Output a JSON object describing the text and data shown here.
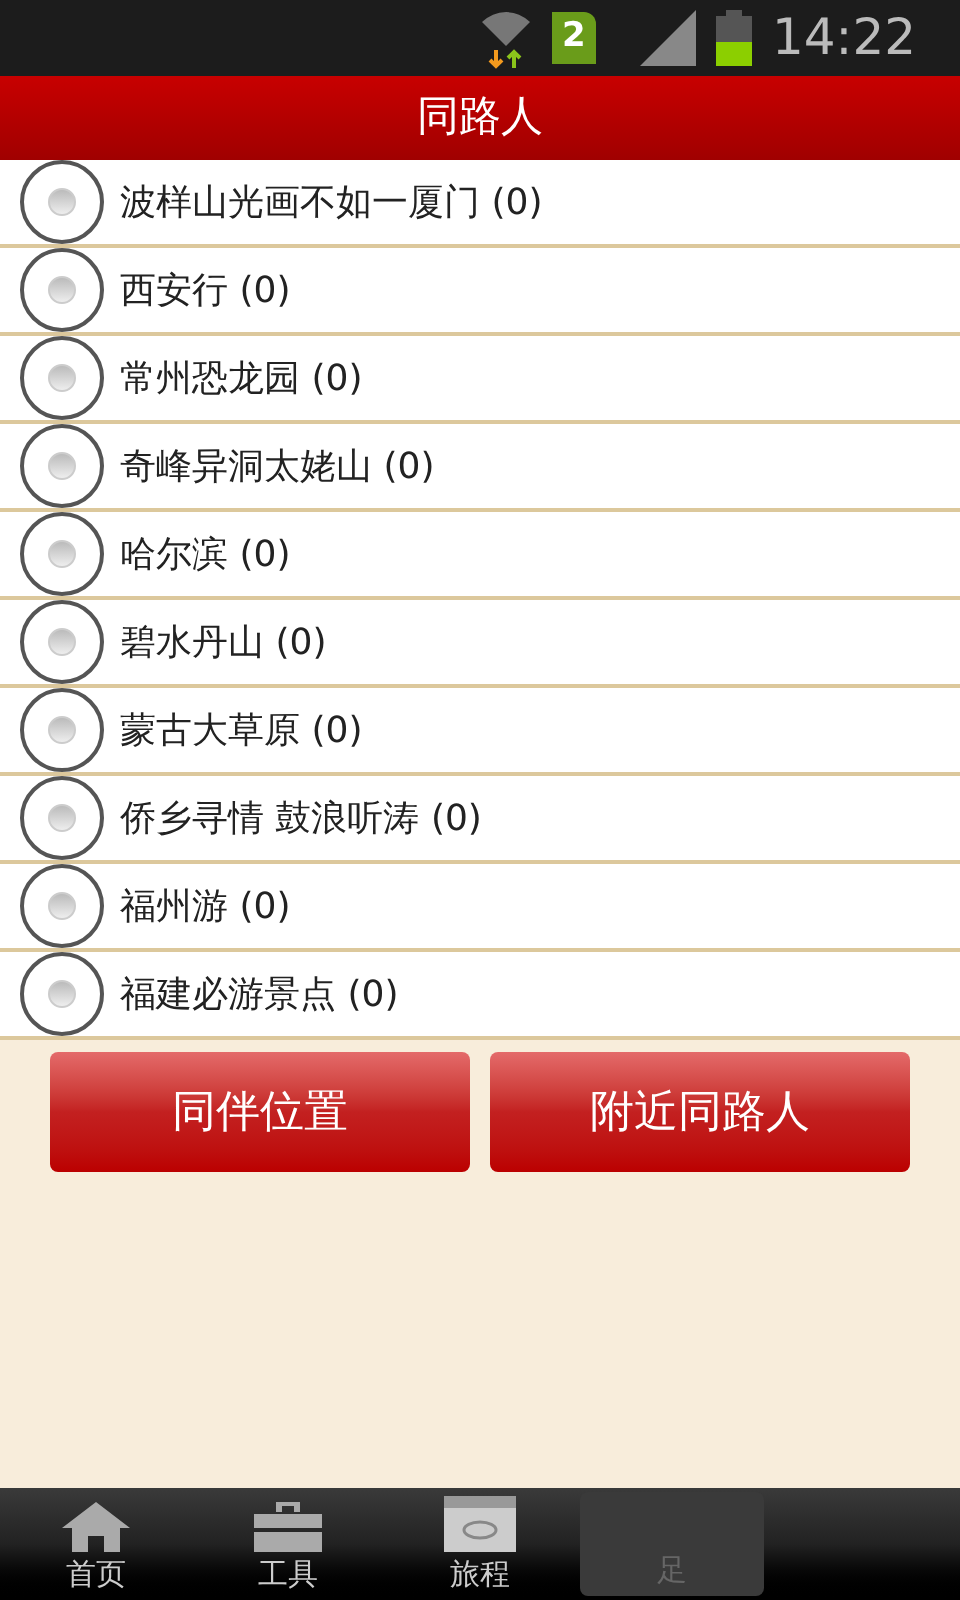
{
  "status_bar": {
    "sim": "2",
    "time": "14:22"
  },
  "title": "同路人",
  "routes": [
    {
      "label": "波样山光画不如一厦门 (0)",
      "selected": false
    },
    {
      "label": "西安行 (0)",
      "selected": false
    },
    {
      "label": "常州恐龙园 (0)",
      "selected": false
    },
    {
      "label": "奇峰异洞太姥山 (0)",
      "selected": false
    },
    {
      "label": "哈尔滨 (0)",
      "selected": false
    },
    {
      "label": "碧水丹山 (0)",
      "selected": false
    },
    {
      "label": "蒙古大草原 (0)",
      "selected": false
    },
    {
      "label": "侨乡寻情 鼓浪听涛 (0)",
      "selected": false
    },
    {
      "label": "福州游 (0)",
      "selected": false
    },
    {
      "label": "福建必游景点 (0)",
      "selected": false
    }
  ],
  "buttons": [
    "同伴位置",
    "附近同路人"
  ],
  "tab_bar": [
    {
      "label": "首页",
      "kind": "home",
      "selected": false
    },
    {
      "label": "工具",
      "kind": "tools",
      "selected": false
    },
    {
      "label": "旅程",
      "kind": "calendar",
      "selected": false
    },
    {
      "label": "足",
      "kind": "none",
      "selected": true
    }
  ]
}
